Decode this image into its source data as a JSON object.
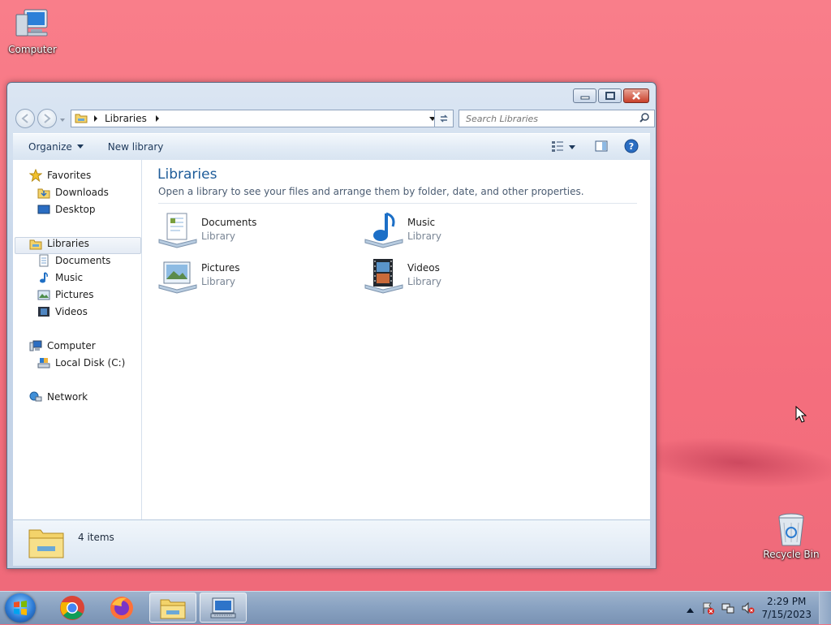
{
  "desktop": {
    "icons": [
      {
        "label": "Computer"
      },
      {
        "label": "Recycle Bin"
      }
    ]
  },
  "window": {
    "address": {
      "root": "Libraries"
    },
    "search": {
      "placeholder": "Search Libraries"
    },
    "toolbar": {
      "organize": "Organize",
      "new_library": "New library"
    },
    "nav": {
      "favorites": "Favorites",
      "downloads": "Downloads",
      "desktop": "Desktop",
      "libraries": "Libraries",
      "documents": "Documents",
      "music": "Music",
      "pictures": "Pictures",
      "videos": "Videos",
      "computer": "Computer",
      "local_disk": "Local Disk (C:)",
      "network": "Network"
    },
    "main": {
      "title": "Libraries",
      "subtitle": "Open a library to see your files and arrange them by folder, date, and other properties.",
      "libraries": [
        {
          "name": "Documents",
          "type": "Library"
        },
        {
          "name": "Music",
          "type": "Library"
        },
        {
          "name": "Pictures",
          "type": "Library"
        },
        {
          "name": "Videos",
          "type": "Library"
        }
      ]
    },
    "details": {
      "count": "4 items"
    }
  },
  "taskbar": {
    "clock": {
      "time": "2:29 PM",
      "date": "7/15/2023"
    }
  },
  "colors": {
    "desktop": "#f5707f",
    "title_accent": "#1e5c99",
    "taskbar": "#8aa3c2"
  }
}
